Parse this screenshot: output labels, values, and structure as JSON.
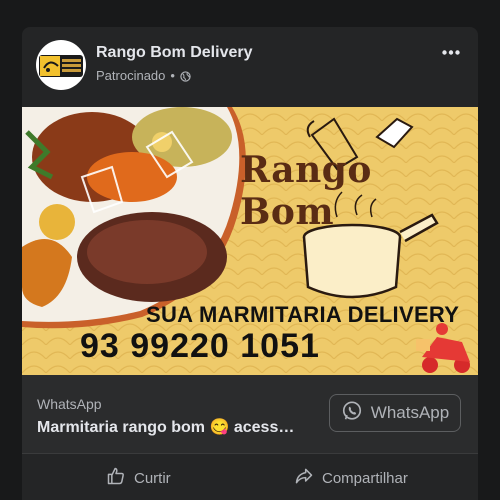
{
  "post": {
    "page_name": "Rango Bom Delivery",
    "sponsored_label": "Patrocinado",
    "separator": "•"
  },
  "ad": {
    "title": "Rango Bom",
    "tagline": "SUA MARMITARIA DELIVERY",
    "phone": "93 99220 1051"
  },
  "cta": {
    "source": "WhatsApp",
    "text": "Marmitaria rango bom 😋 acess…",
    "button_label": "WhatsApp"
  },
  "actions": {
    "like_label": "Curtir",
    "share_label": "Compartilhar"
  },
  "colors": {
    "background": "#18191a",
    "card": "#242526",
    "ad_background": "#eeca6a",
    "brand_text": "#5a2c14"
  },
  "icons": [
    "globe-icon",
    "more-options-icon",
    "whatsapp-icon",
    "like-icon",
    "share-icon",
    "scooter-icon"
  ]
}
